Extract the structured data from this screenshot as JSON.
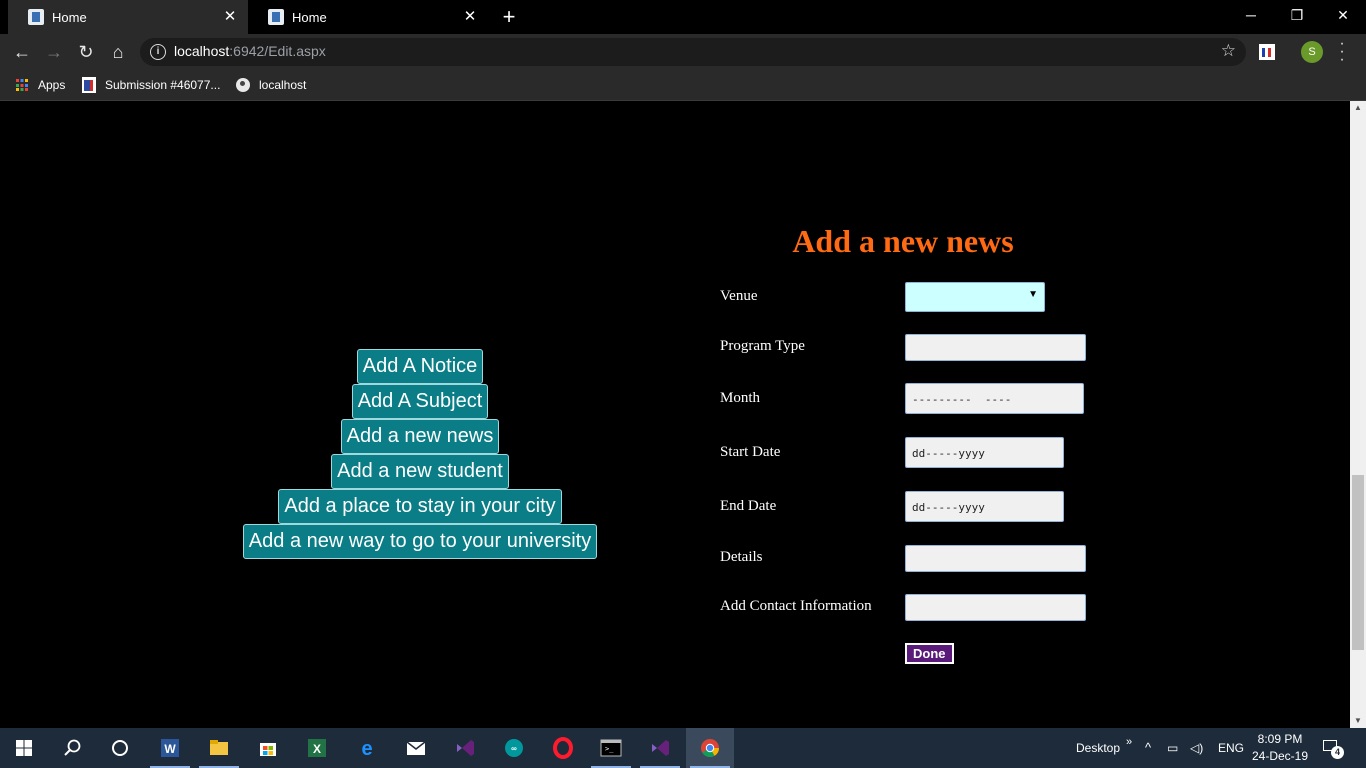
{
  "browser": {
    "tabs": [
      {
        "title": "Home",
        "active": true
      },
      {
        "title": "Home",
        "active": false
      }
    ],
    "url_host": "localhost",
    "url_rest": ":6942/Edit.aspx",
    "profile_initial": "S",
    "bookmarks": [
      {
        "label": "Apps"
      },
      {
        "label": "Submission #46077..."
      },
      {
        "label": "localhost"
      }
    ]
  },
  "sidebar": {
    "buttons": [
      {
        "label": "Add A Notice"
      },
      {
        "label": "Add A Subject"
      },
      {
        "label": "Add a new news"
      },
      {
        "label": "Add a new student"
      },
      {
        "label": "Add a place to stay in your city"
      },
      {
        "label": "Add a new way to go to your university"
      }
    ],
    "button_color": "#0a7d86"
  },
  "form": {
    "title": "Add a new news",
    "title_color": "#ff6a13",
    "fields": {
      "venue": {
        "label": "Venue",
        "value": ""
      },
      "program_type": {
        "label": "Program Type",
        "value": ""
      },
      "month": {
        "label": "Month",
        "placeholder": "---------  ----"
      },
      "start_date": {
        "label": "Start Date",
        "placeholder": "dd-----yyyy"
      },
      "end_date": {
        "label": "End Date",
        "placeholder": "dd-----yyyy"
      },
      "details": {
        "label": "Details",
        "value": ""
      },
      "contact": {
        "label": "Add Contact Information",
        "value": ""
      }
    },
    "submit_label": "Done"
  },
  "taskbar": {
    "apps": [
      "start-icon",
      "search-icon",
      "cortana-icon",
      "word-icon",
      "file-explorer-icon",
      "store-icon",
      "excel-icon",
      "edge-icon",
      "mail-icon",
      "visual-studio-icon",
      "arduino-icon",
      "opera-icon",
      "terminal-icon",
      "visual-studio-2-icon",
      "chrome-icon"
    ],
    "desktop_label": "Desktop",
    "language": "ENG",
    "time": "8:09 PM",
    "date": "24-Dec-19",
    "notification_count": "4"
  }
}
